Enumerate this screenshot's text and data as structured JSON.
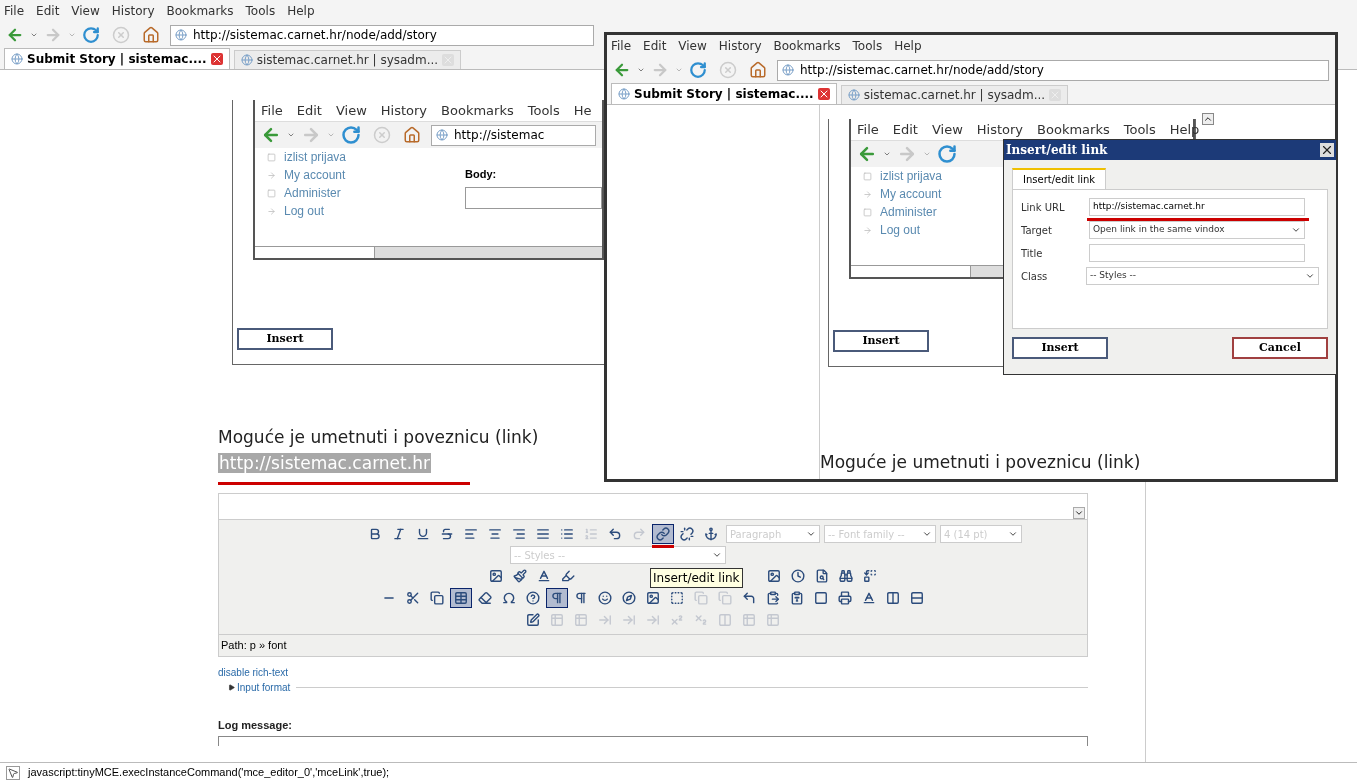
{
  "main": {
    "menu": [
      "File",
      "Edit",
      "View",
      "History",
      "Bookmarks",
      "Tools",
      "Help"
    ],
    "url": "http://sistemac.carnet.hr/node/add/story",
    "tabs": [
      {
        "label": "Submit Story | sistemac....",
        "selected": true
      },
      {
        "label": "sistemac.carnet.hr | sysadm...",
        "selected": false
      }
    ],
    "shot": {
      "menu": [
        "File",
        "Edit",
        "View",
        "History",
        "Bookmarks",
        "Tools",
        "He"
      ],
      "url": "http://sistemac",
      "sidebar": [
        {
          "label": "izlist prijava",
          "kind": "box"
        },
        {
          "label": "My account",
          "kind": "arrow"
        },
        {
          "label": "Administer",
          "kind": "box"
        },
        {
          "label": "Log out",
          "kind": "arrow"
        }
      ],
      "body_label": "Body:",
      "button": "Insert"
    },
    "heading": "Moguće je umetnuti i poveznicu (link)",
    "link": "http://sistemac.carnet.hr",
    "toolbar": {
      "rows": [
        {
          "buttons": [
            {
              "active": false,
              "disabled": false
            },
            {
              "active": false,
              "disabled": false
            },
            {
              "active": false,
              "disabled": false
            },
            {
              "active": false,
              "disabled": false
            },
            {
              "active": false,
              "disabled": false
            },
            {
              "active": false,
              "disabled": false
            },
            {
              "active": false,
              "disabled": false
            },
            {
              "active": false,
              "disabled": false
            },
            {
              "active": false,
              "disabled": false
            },
            {
              "active": false,
              "disabled": true
            },
            {
              "active": false,
              "disabled": false
            },
            {
              "active": false,
              "disabled": true
            },
            {
              "active": true,
              "disabled": false
            },
            {
              "active": false,
              "disabled": false
            },
            {
              "active": false,
              "disabled": false
            }
          ]
        },
        {
          "buttons": [
            {
              "active": false,
              "disabled": false
            },
            {
              "active": false,
              "disabled": false
            },
            {
              "active": false,
              "disabled": false
            },
            {
              "active": false,
              "disabled": false
            },
            {
              "active": false,
              "disabled": false
            },
            {
              "active": false,
              "disabled": false
            },
            {
              "active": false,
              "disabled": false
            },
            {
              "active": false,
              "disabled": false
            },
            {
              "active": false,
              "disabled": false
            }
          ]
        },
        {
          "buttons": [
            {
              "active": false,
              "disabled": false
            },
            {
              "active": false,
              "disabled": false
            },
            {
              "active": false,
              "disabled": false
            },
            {
              "active": true,
              "disabled": false
            },
            {
              "active": false,
              "disabled": false
            },
            {
              "active": false,
              "disabled": false
            },
            {
              "active": false,
              "disabled": false
            },
            {
              "active": true,
              "disabled": false
            },
            {
              "active": false,
              "disabled": false
            },
            {
              "active": false,
              "disabled": false
            },
            {
              "active": false,
              "disabled": false
            },
            {
              "active": false,
              "disabled": false
            },
            {
              "active": false,
              "disabled": false
            },
            {
              "active": false,
              "disabled": true
            },
            {
              "active": false,
              "disabled": true
            },
            {
              "active": false,
              "disabled": false
            },
            {
              "active": false,
              "disabled": false
            },
            {
              "active": false,
              "disabled": false
            },
            {
              "active": false,
              "disabled": false
            },
            {
              "active": false,
              "disabled": false
            },
            {
              "active": false,
              "disabled": false
            },
            {
              "active": false,
              "disabled": false
            },
            {
              "active": false,
              "disabled": false
            }
          ]
        },
        {
          "buttons": [
            {
              "active": false,
              "disabled": false
            },
            {
              "active": false,
              "disabled": true
            },
            {
              "active": false,
              "disabled": true
            },
            {
              "active": false,
              "disabled": true
            },
            {
              "active": false,
              "disabled": true
            },
            {
              "active": false,
              "disabled": true
            },
            {
              "active": false,
              "disabled": true
            },
            {
              "active": false,
              "disabled": true
            },
            {
              "active": false,
              "disabled": true
            },
            {
              "active": false,
              "disabled": true
            },
            {
              "active": false,
              "disabled": true
            }
          ]
        }
      ],
      "selects": [
        "Paragraph",
        "-- Font family --",
        "4 (14 pt)"
      ],
      "styles": "-- Styles --",
      "tooltip": "Insert/edit link"
    },
    "path": "Path: p » font",
    "rich_text_link": "disable rich-text",
    "input_format": "Input format",
    "log_label": "Log message:"
  },
  "overlay": {
    "menu": [
      "File",
      "Edit",
      "View",
      "History",
      "Bookmarks",
      "Tools",
      "Help"
    ],
    "url": "http://sistemac.carnet.hr/node/add/story",
    "tabs": [
      {
        "label": "Submit Story | sistemac....",
        "selected": true
      },
      {
        "label": "sistemac.carnet.hr | sysadm...",
        "selected": false
      }
    ],
    "shot": {
      "menu": [
        "File",
        "Edit",
        "View",
        "History",
        "Bookmarks",
        "Tools",
        "Help"
      ],
      "sidebar": [
        {
          "label": "izlist prijava",
          "kind": "box"
        },
        {
          "label": "My account",
          "kind": "arrow"
        },
        {
          "label": "Administer",
          "kind": "box"
        },
        {
          "label": "Log out",
          "kind": "arrow"
        }
      ],
      "button": "Insert"
    },
    "dialog": {
      "title": "Insert/edit link",
      "tab": "Insert/edit link",
      "fields": [
        {
          "label": "Link URL",
          "kind": "text",
          "value": "http://sistemac.carnet.hr"
        },
        {
          "label": "Target",
          "kind": "select",
          "value": "Open link in the same vindox"
        },
        {
          "label": "Title",
          "kind": "text"
        },
        {
          "label": "Class",
          "kind": "select",
          "value": "-- Styles --"
        }
      ],
      "buttons": [
        "Insert",
        "Cancel"
      ]
    },
    "heading": "Moguće je umetnuti i poveznicu (link)"
  },
  "status": "javascript:tinyMCE.execInstanceCommand('mce_editor_0','mceLink',true);"
}
